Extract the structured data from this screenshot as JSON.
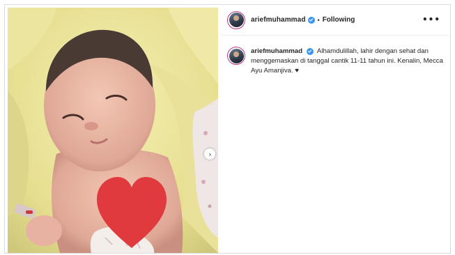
{
  "post": {
    "username": "ariefmuhammad",
    "separator": "•",
    "follow_state": "Following",
    "more_icon": "•••",
    "next_icon": "›",
    "caption_text": "Alhamdulillah, lahir dengan sehat dan menggemaskan di tanggal cantik 11-11 tahun ini. Kenalin, Mecca Ayu Amanjiva. ♥"
  },
  "icons": {
    "verified": "verified-badge-icon",
    "more": "more-options-icon",
    "next": "chevron-right-icon",
    "heart": "heart-sticker-icon"
  },
  "colors": {
    "verified": "#3897f0",
    "story_ring": "#c13584",
    "heart_sticker": "#e0393e",
    "border": "#dbdbdb"
  }
}
